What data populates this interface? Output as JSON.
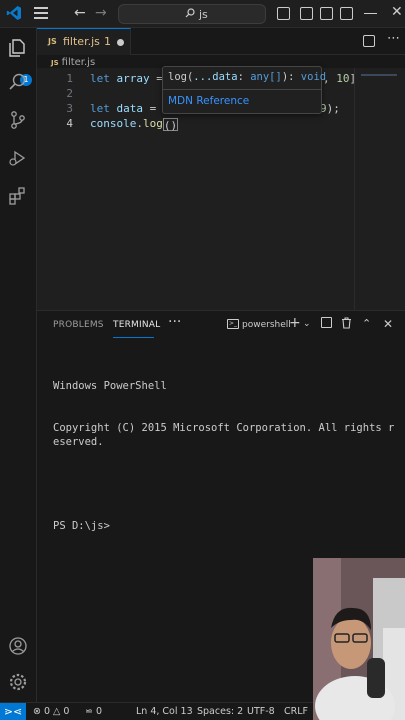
{
  "titlebar": {
    "search_text": "js"
  },
  "activitybar": {
    "badge_count": "1"
  },
  "tab": {
    "lang": "JS",
    "filename": "filter.js",
    "problems": "1"
  },
  "breadcrumb": {
    "lang": "JS",
    "file": "filter.js"
  },
  "editor": {
    "line_numbers": [
      "1",
      "2",
      "3",
      "4"
    ],
    "lines": [
      {
        "kw": "let",
        "var": "array",
        "rest_before": " = ",
        "hidden_num_tail": ", 10];"
      },
      {
        "text": ""
      },
      {
        "kw": "let",
        "var": "data",
        "rest_before": " = a",
        "tail": "9);"
      },
      {
        "obj": "console",
        "dot": ".",
        "fn": "log",
        "paren_open": "(",
        "paren_close": ")"
      }
    ]
  },
  "hover": {
    "signature_fn": "log",
    "signature_open": "(",
    "signature_param": "...data",
    "signature_colon": ": ",
    "signature_type": "any[]",
    "signature_close": "): ",
    "signature_return": "void",
    "link_text": "MDN Reference"
  },
  "panel": {
    "tabs": [
      {
        "label": "PROBLEMS",
        "active": false
      },
      {
        "label": "TERMINAL",
        "active": true
      }
    ],
    "more": "···",
    "shell_name": "powershell",
    "terminal_lines": [
      "Windows PowerShell",
      "Copyright (C) 2015 Microsoft Corporation. All rights reserved.",
      "",
      "PS D:\\js>"
    ]
  },
  "statusbar": {
    "errors": "0",
    "warnings": "0",
    "ports": "0",
    "position": "Ln 4, Col 13",
    "spaces": "Spaces: 2",
    "encoding": "UTF-8",
    "eol": "CRLF"
  },
  "colors": {
    "accent": "#0078d4",
    "keyword": "#569cd6",
    "variable": "#9cdcfe",
    "function": "#dcdcaa",
    "number": "#b5cea8",
    "modified_tab": "#e2c08d",
    "link": "#3794ff"
  }
}
